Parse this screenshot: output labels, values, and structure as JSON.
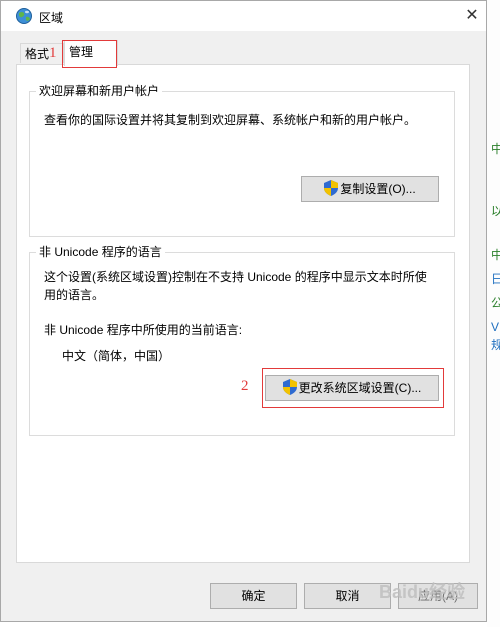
{
  "window": {
    "title": "区域",
    "close_glyph": "✕"
  },
  "tabs": [
    {
      "label": "格式"
    },
    {
      "label": "管理"
    }
  ],
  "annotations": {
    "first": "1",
    "second": "2"
  },
  "welcome_group": {
    "title": "欢迎屏幕和新用户帐户",
    "description": "查看你的国际设置并将其复制到欢迎屏幕、系统帐户和新的用户帐户。",
    "copy_button": "复制设置(O)..."
  },
  "non_unicode_group": {
    "title": "非 Unicode 程序的语言",
    "description_line1": "这个设置(系统区域设置)控制在不支持 Unicode 的程序中显示文本时所使",
    "description_line2": "用的语言。",
    "current_label": "非 Unicode 程序中所使用的当前语言:",
    "current_value": "中文（简体，中国）",
    "change_button": "更改系统区域设置(C)..."
  },
  "footer": {
    "ok_label": "确定",
    "cancel_label": "取消",
    "apply_label": "应用(A)"
  },
  "watermark_text": "Baidu经验",
  "background_edge_chars": [
    "中",
    "以",
    "中",
    "日",
    "公",
    "V",
    "规"
  ],
  "colors": {
    "annotation_red": "#e23a3a",
    "button_face": "#e1e1e1",
    "window_bg": "#f0f0f0"
  },
  "icons": {
    "title": "globe-region-icon",
    "shield": "uac-shield-icon",
    "close": "close-icon"
  }
}
